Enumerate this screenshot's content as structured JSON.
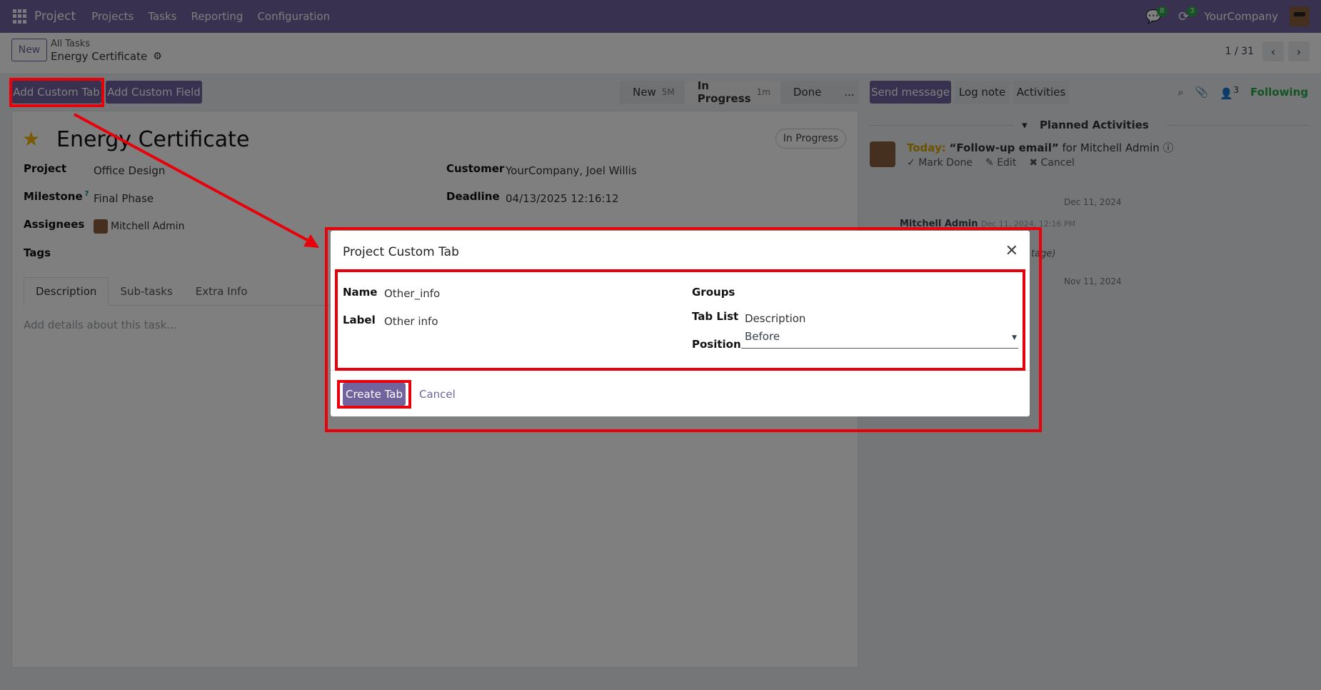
{
  "topbar": {
    "app_name": "Project",
    "menu": [
      "Projects",
      "Tasks",
      "Reporting",
      "Configuration"
    ],
    "messages_count": "8",
    "activities_count": "3",
    "company": "YourCompany"
  },
  "control": {
    "new_label": "New",
    "breadcrumb_parent": "All Tasks",
    "breadcrumb_current": "Energy Certificate",
    "pager": "1 / 31"
  },
  "actions": {
    "add_custom_tab": "Add Custom Tab",
    "add_custom_field": "Add Custom Field"
  },
  "statusbar": [
    {
      "label": "New",
      "time": "5M"
    },
    {
      "label": "In Progress",
      "time": "1m"
    },
    {
      "label": "Done",
      "time": ""
    },
    {
      "label": "...",
      "time": ""
    }
  ],
  "task": {
    "title": "Energy Certificate",
    "status": "In Progress",
    "project_label": "Project",
    "project": "Office Design",
    "milestone_label": "Milestone",
    "milestone_help": "?",
    "milestone": "Final Phase",
    "assignees_label": "Assignees",
    "assignee": "Mitchell Admin",
    "tags_label": "Tags",
    "customer_label": "Customer",
    "customer": "YourCompany, Joel Willis",
    "deadline_label": "Deadline",
    "deadline": "04/13/2025 12:16:12",
    "tabs": [
      "Description",
      "Sub-tasks",
      "Extra Info"
    ],
    "description_placeholder": "Add details about this task..."
  },
  "chatter": {
    "send_message": "Send message",
    "log_note": "Log note",
    "activities": "Activities",
    "followers_count": "3",
    "following": "Following",
    "planned_activities": "Planned Activities",
    "activity_today": "Today:",
    "activity_summary": "“Follow-up email”",
    "activity_for": "for Mitchell Admin",
    "mark_done": "Mark Done",
    "edit": "Edit",
    "cancel": "Cancel",
    "date1": "Dec 11, 2024",
    "message_author": "Mitchell Admin",
    "message_date": "Dec 11, 2024, 12:16 PM",
    "message_fragment": "tage)",
    "date2": "Nov 11, 2024"
  },
  "modal": {
    "title": "Project Custom Tab",
    "name_label": "Name",
    "name_value": "Other_info",
    "label_label": "Label",
    "label_value": "Other info",
    "groups_label": "Groups",
    "tab_list_label": "Tab List",
    "tab_list_value": "Description",
    "position_label": "Position",
    "position_value": "Before",
    "create_button": "Create Tab",
    "cancel_button": "Cancel"
  },
  "colors": {
    "brand": "#71639e",
    "highlight": "#e8000b",
    "following": "#28a745"
  }
}
